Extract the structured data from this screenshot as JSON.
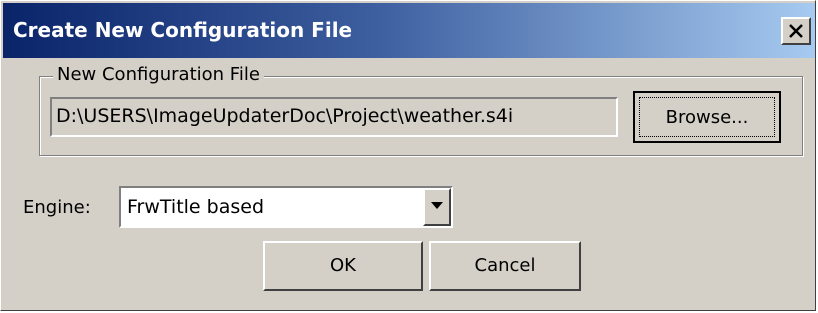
{
  "window": {
    "title": "Create New Configuration File",
    "close_icon": "close-icon"
  },
  "group": {
    "legend": "New Configuration File",
    "path_value": "D:\\USERS\\ImageUpdaterDoc\\Project\\weather.s4i",
    "browse_label": "Browse..."
  },
  "engine": {
    "label": "Engine:",
    "selected": "FrwTitle based",
    "dropdown_icon": "chevron-down-icon"
  },
  "buttons": {
    "ok_label": "OK",
    "cancel_label": "Cancel"
  },
  "colors": {
    "title_gradient_start": "#0a246a",
    "title_gradient_end": "#a6caf0",
    "dialog_bg": "#d4d0c8"
  }
}
